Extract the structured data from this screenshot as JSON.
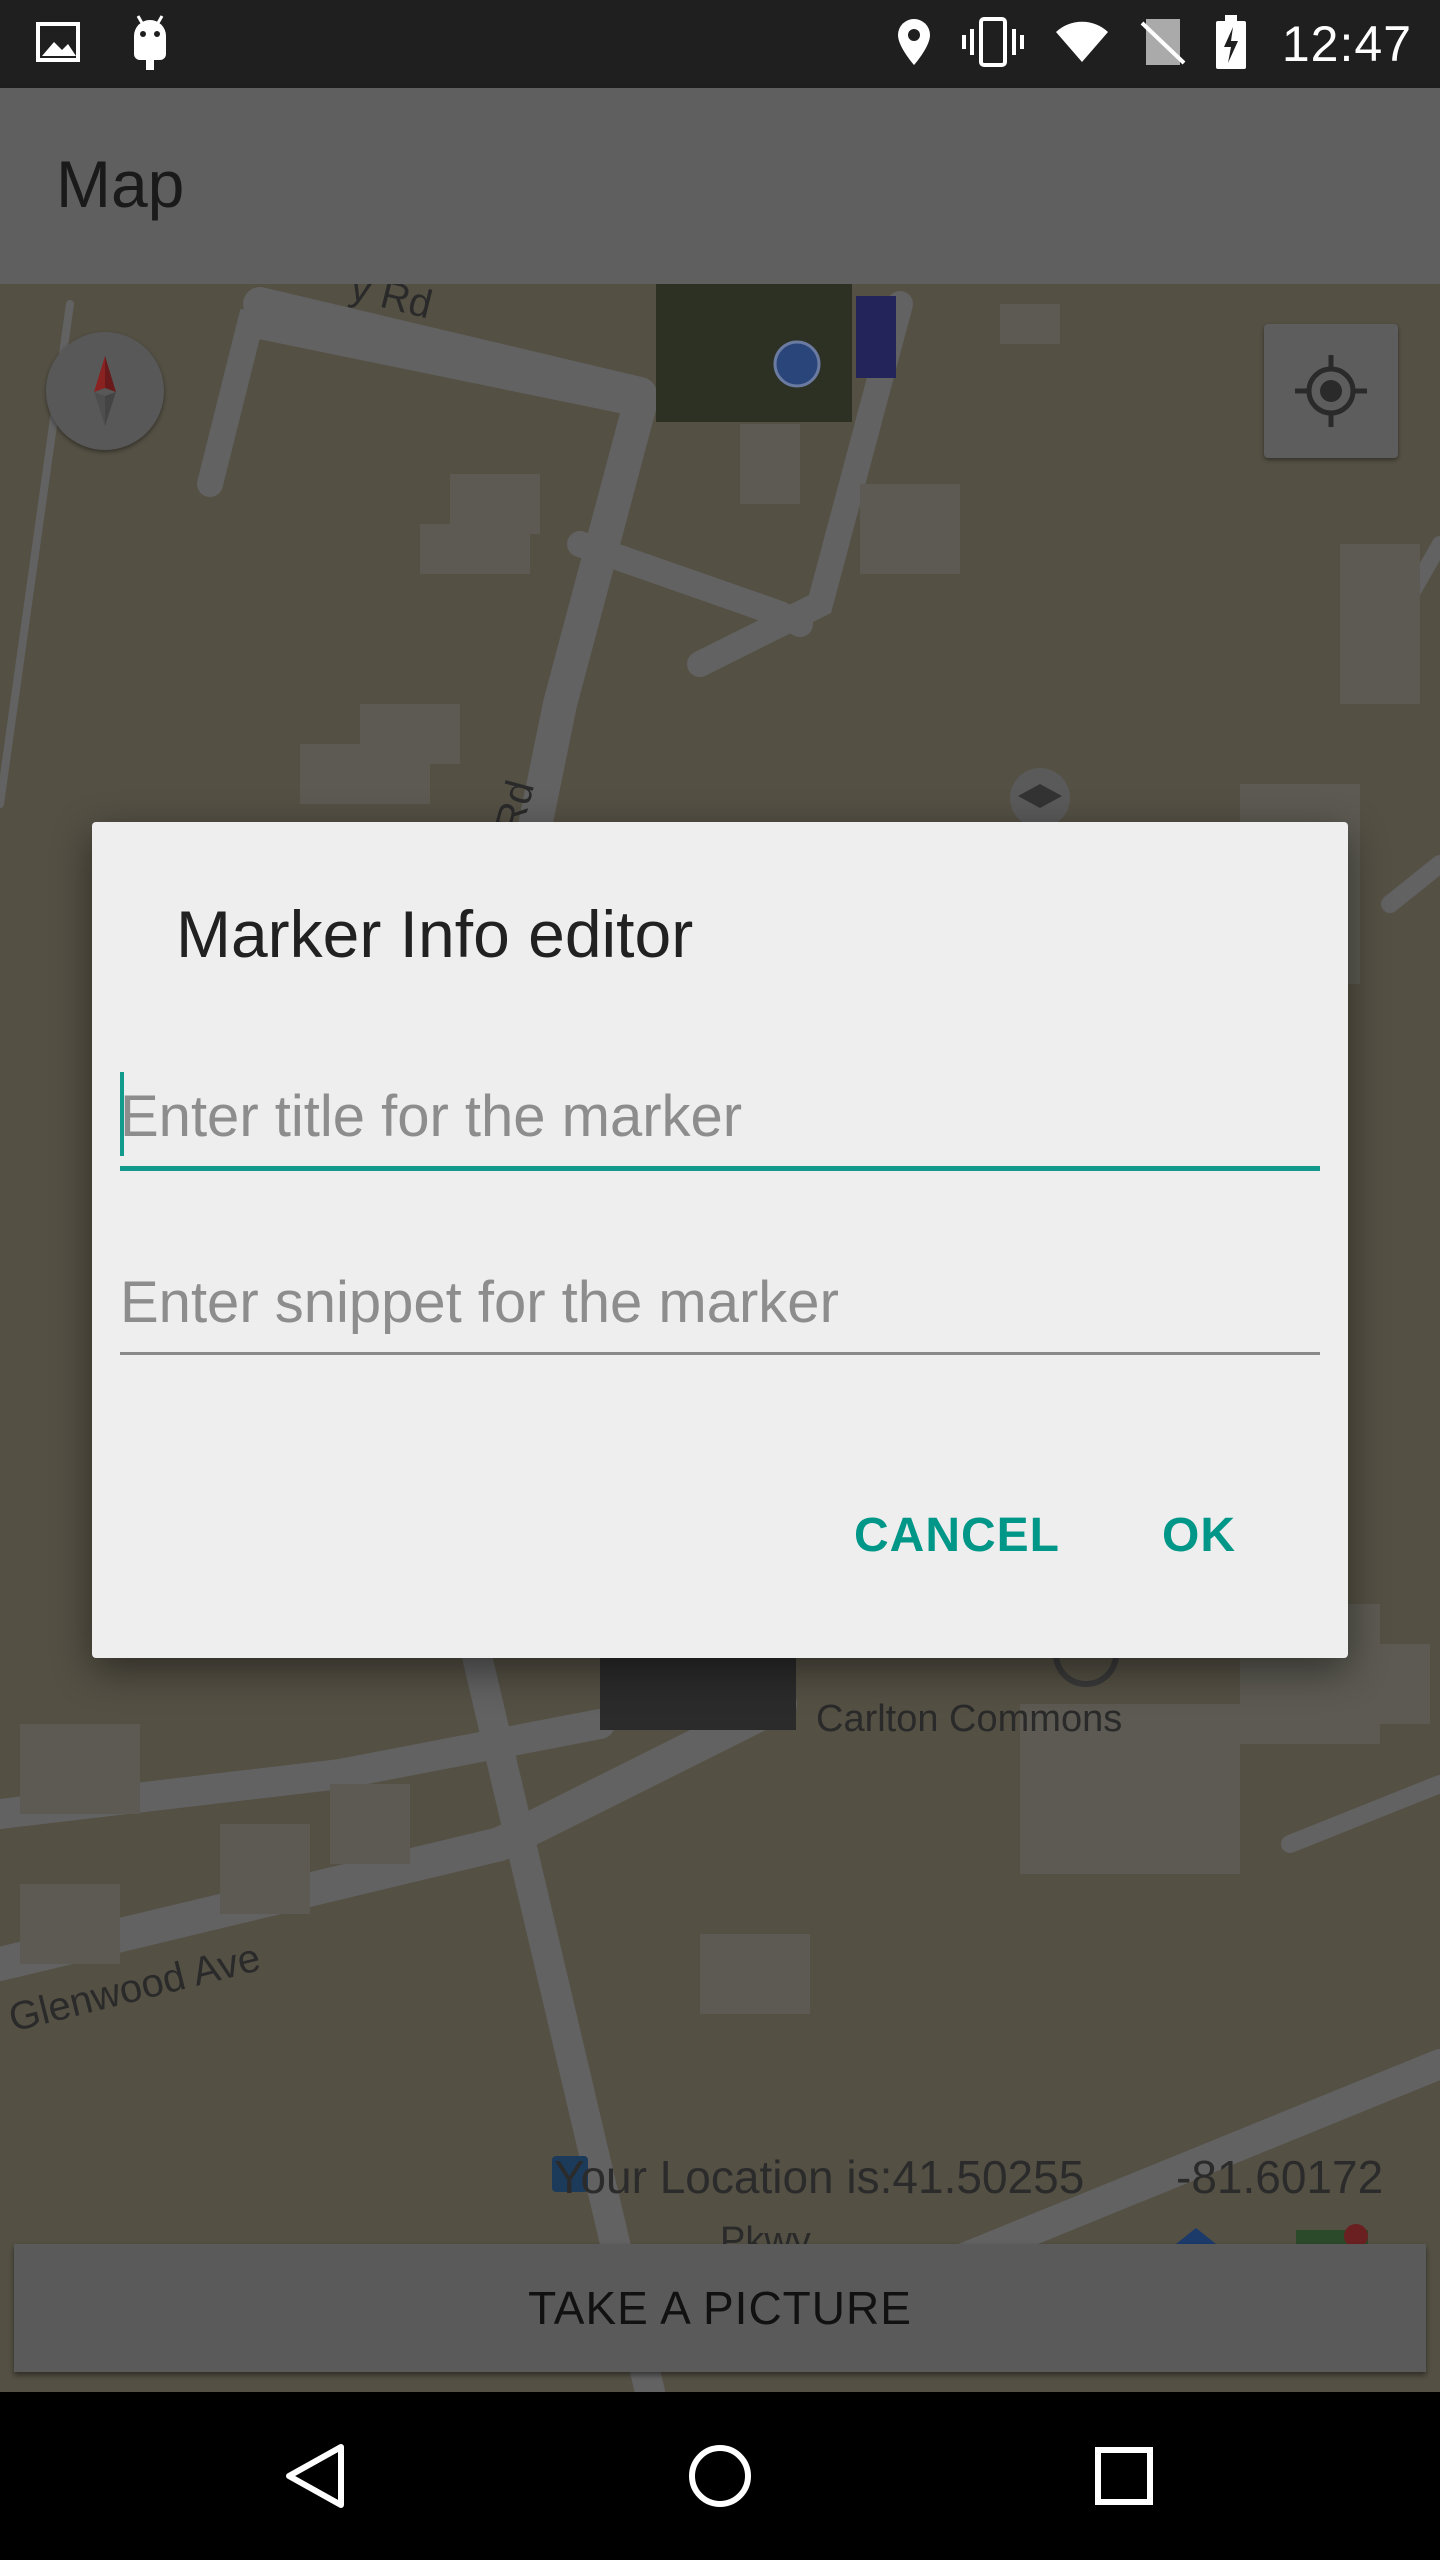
{
  "status_bar": {
    "time": "12:47",
    "left_icons": [
      "image-icon",
      "android-icon"
    ],
    "right_icons": [
      "location-pin-icon",
      "vibrate-icon",
      "wifi-icon",
      "no-sim-icon",
      "battery-charging-icon"
    ]
  },
  "app_bar": {
    "title": "Map"
  },
  "map": {
    "labels": {
      "road_top": "y Rd",
      "road_mid": "Rd",
      "place": "Carlton Commons",
      "street": "Glenwood Ave",
      "parkway": "Pkwy"
    },
    "location_prefix": "Your Location is:41.50255",
    "location_longitude": "-81.60172"
  },
  "dialog": {
    "title": "Marker Info editor",
    "title_field": {
      "value": "",
      "placeholder": "Enter title for the marker"
    },
    "snippet_field": {
      "value": "",
      "placeholder": "Enter snippet for the marker"
    },
    "cancel_label": "CANCEL",
    "ok_label": "OK"
  },
  "take_picture_label": "TAKE A PICTURE",
  "colors": {
    "accent": "#009688",
    "dialog_bg": "#eeeeee",
    "scrim_map": "#545044"
  }
}
